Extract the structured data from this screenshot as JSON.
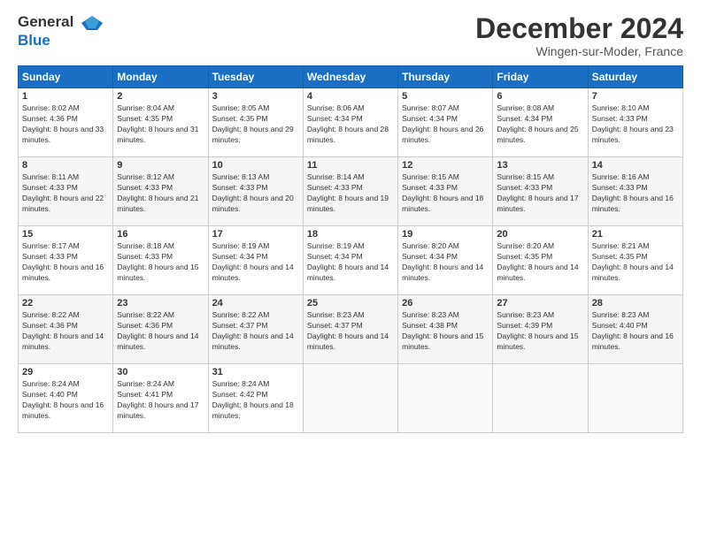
{
  "logo": {
    "line1": "General",
    "line2": "Blue"
  },
  "title": "December 2024",
  "location": "Wingen-sur-Moder, France",
  "days_header": [
    "Sunday",
    "Monday",
    "Tuesday",
    "Wednesday",
    "Thursday",
    "Friday",
    "Saturday"
  ],
  "weeks": [
    [
      {
        "num": "1",
        "sunrise": "8:02 AM",
        "sunset": "4:36 PM",
        "daylight": "8 hours and 33 minutes."
      },
      {
        "num": "2",
        "sunrise": "8:04 AM",
        "sunset": "4:35 PM",
        "daylight": "8 hours and 31 minutes."
      },
      {
        "num": "3",
        "sunrise": "8:05 AM",
        "sunset": "4:35 PM",
        "daylight": "8 hours and 29 minutes."
      },
      {
        "num": "4",
        "sunrise": "8:06 AM",
        "sunset": "4:34 PM",
        "daylight": "8 hours and 28 minutes."
      },
      {
        "num": "5",
        "sunrise": "8:07 AM",
        "sunset": "4:34 PM",
        "daylight": "8 hours and 26 minutes."
      },
      {
        "num": "6",
        "sunrise": "8:08 AM",
        "sunset": "4:34 PM",
        "daylight": "8 hours and 25 minutes."
      },
      {
        "num": "7",
        "sunrise": "8:10 AM",
        "sunset": "4:33 PM",
        "daylight": "8 hours and 23 minutes."
      }
    ],
    [
      {
        "num": "8",
        "sunrise": "8:11 AM",
        "sunset": "4:33 PM",
        "daylight": "8 hours and 22 minutes."
      },
      {
        "num": "9",
        "sunrise": "8:12 AM",
        "sunset": "4:33 PM",
        "daylight": "8 hours and 21 minutes."
      },
      {
        "num": "10",
        "sunrise": "8:13 AM",
        "sunset": "4:33 PM",
        "daylight": "8 hours and 20 minutes."
      },
      {
        "num": "11",
        "sunrise": "8:14 AM",
        "sunset": "4:33 PM",
        "daylight": "8 hours and 19 minutes."
      },
      {
        "num": "12",
        "sunrise": "8:15 AM",
        "sunset": "4:33 PM",
        "daylight": "8 hours and 18 minutes."
      },
      {
        "num": "13",
        "sunrise": "8:15 AM",
        "sunset": "4:33 PM",
        "daylight": "8 hours and 17 minutes."
      },
      {
        "num": "14",
        "sunrise": "8:16 AM",
        "sunset": "4:33 PM",
        "daylight": "8 hours and 16 minutes."
      }
    ],
    [
      {
        "num": "15",
        "sunrise": "8:17 AM",
        "sunset": "4:33 PM",
        "daylight": "8 hours and 16 minutes."
      },
      {
        "num": "16",
        "sunrise": "8:18 AM",
        "sunset": "4:33 PM",
        "daylight": "8 hours and 15 minutes."
      },
      {
        "num": "17",
        "sunrise": "8:19 AM",
        "sunset": "4:34 PM",
        "daylight": "8 hours and 14 minutes."
      },
      {
        "num": "18",
        "sunrise": "8:19 AM",
        "sunset": "4:34 PM",
        "daylight": "8 hours and 14 minutes."
      },
      {
        "num": "19",
        "sunrise": "8:20 AM",
        "sunset": "4:34 PM",
        "daylight": "8 hours and 14 minutes."
      },
      {
        "num": "20",
        "sunrise": "8:20 AM",
        "sunset": "4:35 PM",
        "daylight": "8 hours and 14 minutes."
      },
      {
        "num": "21",
        "sunrise": "8:21 AM",
        "sunset": "4:35 PM",
        "daylight": "8 hours and 14 minutes."
      }
    ],
    [
      {
        "num": "22",
        "sunrise": "8:22 AM",
        "sunset": "4:36 PM",
        "daylight": "8 hours and 14 minutes."
      },
      {
        "num": "23",
        "sunrise": "8:22 AM",
        "sunset": "4:36 PM",
        "daylight": "8 hours and 14 minutes."
      },
      {
        "num": "24",
        "sunrise": "8:22 AM",
        "sunset": "4:37 PM",
        "daylight": "8 hours and 14 minutes."
      },
      {
        "num": "25",
        "sunrise": "8:23 AM",
        "sunset": "4:37 PM",
        "daylight": "8 hours and 14 minutes."
      },
      {
        "num": "26",
        "sunrise": "8:23 AM",
        "sunset": "4:38 PM",
        "daylight": "8 hours and 15 minutes."
      },
      {
        "num": "27",
        "sunrise": "8:23 AM",
        "sunset": "4:39 PM",
        "daylight": "8 hours and 15 minutes."
      },
      {
        "num": "28",
        "sunrise": "8:23 AM",
        "sunset": "4:40 PM",
        "daylight": "8 hours and 16 minutes."
      }
    ],
    [
      {
        "num": "29",
        "sunrise": "8:24 AM",
        "sunset": "4:40 PM",
        "daylight": "8 hours and 16 minutes."
      },
      {
        "num": "30",
        "sunrise": "8:24 AM",
        "sunset": "4:41 PM",
        "daylight": "8 hours and 17 minutes."
      },
      {
        "num": "31",
        "sunrise": "8:24 AM",
        "sunset": "4:42 PM",
        "daylight": "8 hours and 18 minutes."
      },
      null,
      null,
      null,
      null
    ]
  ]
}
